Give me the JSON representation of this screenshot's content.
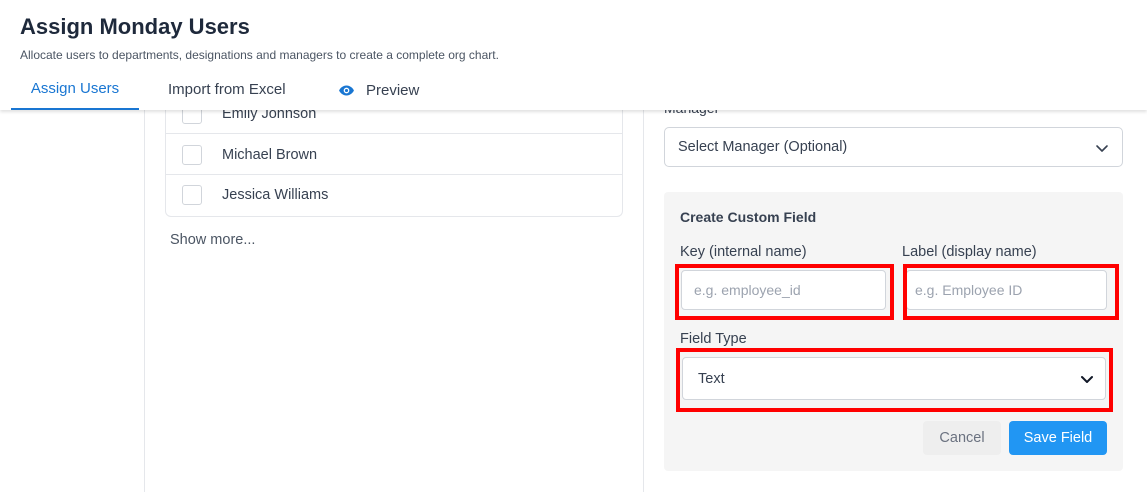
{
  "header": {
    "title": "Assign Monday Users",
    "subtitle": "Allocate users to departments, designations and managers to create a complete org chart."
  },
  "tabs": [
    {
      "label": "Assign Users",
      "active": true
    },
    {
      "label": "Import from Excel",
      "active": false
    },
    {
      "label": "Preview",
      "active": false,
      "icon": "eye-icon"
    }
  ],
  "users": {
    "items": [
      "Emily Johnson",
      "Michael Brown",
      "Jessica Williams"
    ],
    "show_more": "Show more..."
  },
  "manager": {
    "label": "Manager",
    "value": "Select Manager (Optional)"
  },
  "custom_field": {
    "title": "Create Custom Field",
    "key_label": "Key (internal name)",
    "key_placeholder": "e.g. employee_id",
    "label_label": "Label (display name)",
    "label_placeholder": "e.g. Employee ID",
    "type_label": "Field Type",
    "type_value": "Text",
    "cancel": "Cancel",
    "save": "Save Field"
  },
  "colors": {
    "accent": "#1976d2",
    "primary_button": "#2196f3",
    "highlight": "#ff0000"
  }
}
